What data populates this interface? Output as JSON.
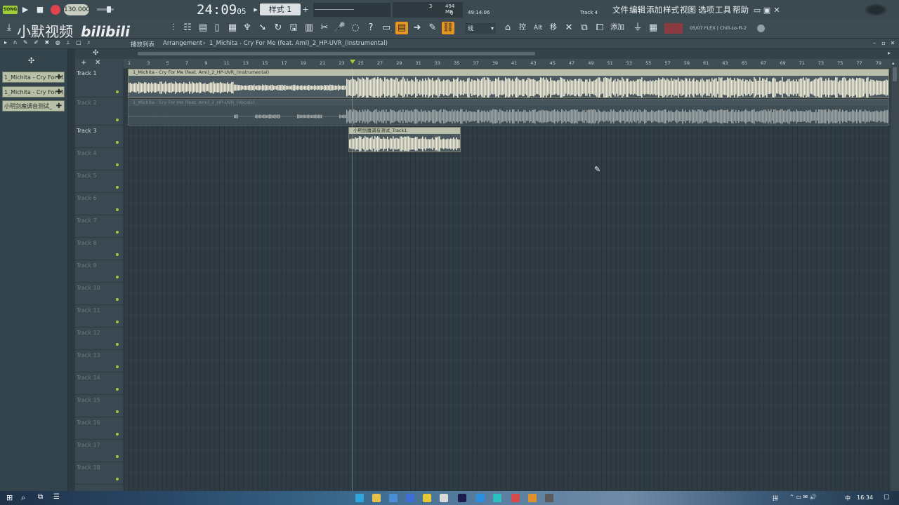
{
  "topbar": {
    "song_badge": "SONG",
    "tempo": "130.000",
    "time": "24:09",
    "time_sub": "05",
    "pattern": "样式 1",
    "cpu_value": "3",
    "memory": "494 MB",
    "voices": "0",
    "clock": "49:14:06",
    "hint_track": "Track 4",
    "menu": [
      "文件",
      "编辑",
      "添加",
      "样式",
      "视图",
      "选项",
      "工具",
      "帮助"
    ]
  },
  "toolbar": {
    "snap_label": "线",
    "label_control": "控",
    "label_alt": "Alt",
    "label_move": "移",
    "add_label": "添加",
    "preset": "05/07  FLEX | Chill-Lo-Fi-2"
  },
  "watermark": {
    "text": "小默视频",
    "brand": "bilibili"
  },
  "breadcrumb": {
    "prefix": "播放列表",
    "items": [
      "Arrangement",
      "1_Michita - Cry For Me (feat. Ami)_2_HP-UVR_(Instrumental)"
    ]
  },
  "clip_browser": [
    {
      "label": "1_Michita - Cry For M..."
    },
    {
      "label": "1_Michita - Cry For M..."
    },
    {
      "label": "小明剑魔调音测试_"
    }
  ],
  "ruler": [
    "1",
    "3",
    "5",
    "7",
    "9",
    "11",
    "13",
    "15",
    "17",
    "19",
    "21",
    "23",
    "25",
    "27",
    "29",
    "31",
    "33",
    "35",
    "37",
    "39",
    "41",
    "43",
    "45",
    "47",
    "49",
    "51",
    "53",
    "55",
    "57",
    "59",
    "61",
    "63",
    "65",
    "67",
    "69",
    "71",
    "73",
    "75",
    "77",
    "79"
  ],
  "tracks": [
    {
      "name": "Track 1",
      "dim": false
    },
    {
      "name": "Track 2",
      "dim": true
    },
    {
      "name": "Track 3",
      "dim": false
    },
    {
      "name": "Track 4",
      "dim": true
    },
    {
      "name": "Track 5",
      "dim": true
    },
    {
      "name": "Track 6",
      "dim": true
    },
    {
      "name": "Track 7",
      "dim": true
    },
    {
      "name": "Track 8",
      "dim": true
    },
    {
      "name": "Track 9",
      "dim": true
    },
    {
      "name": "Track 10",
      "dim": true
    },
    {
      "name": "Track 11",
      "dim": true
    },
    {
      "name": "Track 12",
      "dim": true
    },
    {
      "name": "Track 13",
      "dim": true
    },
    {
      "name": "Track 14",
      "dim": true
    },
    {
      "name": "Track 15",
      "dim": true
    },
    {
      "name": "Track 16",
      "dim": true
    },
    {
      "name": "Track 17",
      "dim": true
    },
    {
      "name": "Track 18",
      "dim": true
    }
  ],
  "clips": {
    "instrumental": "1_Michita - Cry For Me (feat. Ami)_2_HP-UVR_(Instrumental)",
    "vocals": "1_Michita - Cry For Me (feat. Ami)_2_HP-UVR_(Vocals)",
    "track3": "小明剑魔调音测试_Track1"
  },
  "taskbar": {
    "ime": "拼",
    "time": "16:34",
    "lang": "中"
  },
  "colors": {
    "accent_orange": "#e8961f",
    "green_led": "#9fce38",
    "clip_light": "#e9e6d2",
    "clip_muted": "#9aa3a3"
  }
}
